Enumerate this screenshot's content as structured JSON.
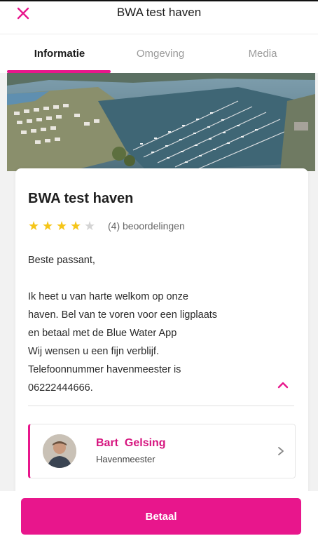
{
  "header": {
    "title": "BWA test haven",
    "close_icon": "close-icon"
  },
  "tabs": [
    {
      "label": "Informatie",
      "active": true
    },
    {
      "label": "Omgeving",
      "active": false
    },
    {
      "label": "Media",
      "active": false
    }
  ],
  "harbour": {
    "name": "BWA test haven",
    "rating": 4,
    "rating_max": 5,
    "reviews_label": "(4) beoordelingen",
    "description": [
      "Beste passant,",
      "",
      "Ik heet u van harte welkom op onze",
      "haven. Bel van te voren voor een ligplaats",
      "en betaal met de Blue Water App",
      "Wij wensen u een fijn verblijf.",
      "Telefoonnummer havenmeester is",
      "06222444666."
    ]
  },
  "contact": {
    "name": "Bart  Gelsing",
    "role": "Havenmeester"
  },
  "actions": {
    "pay_label": "Betaal"
  },
  "colors": {
    "accent": "#e8168c",
    "star": "#f5c518"
  }
}
